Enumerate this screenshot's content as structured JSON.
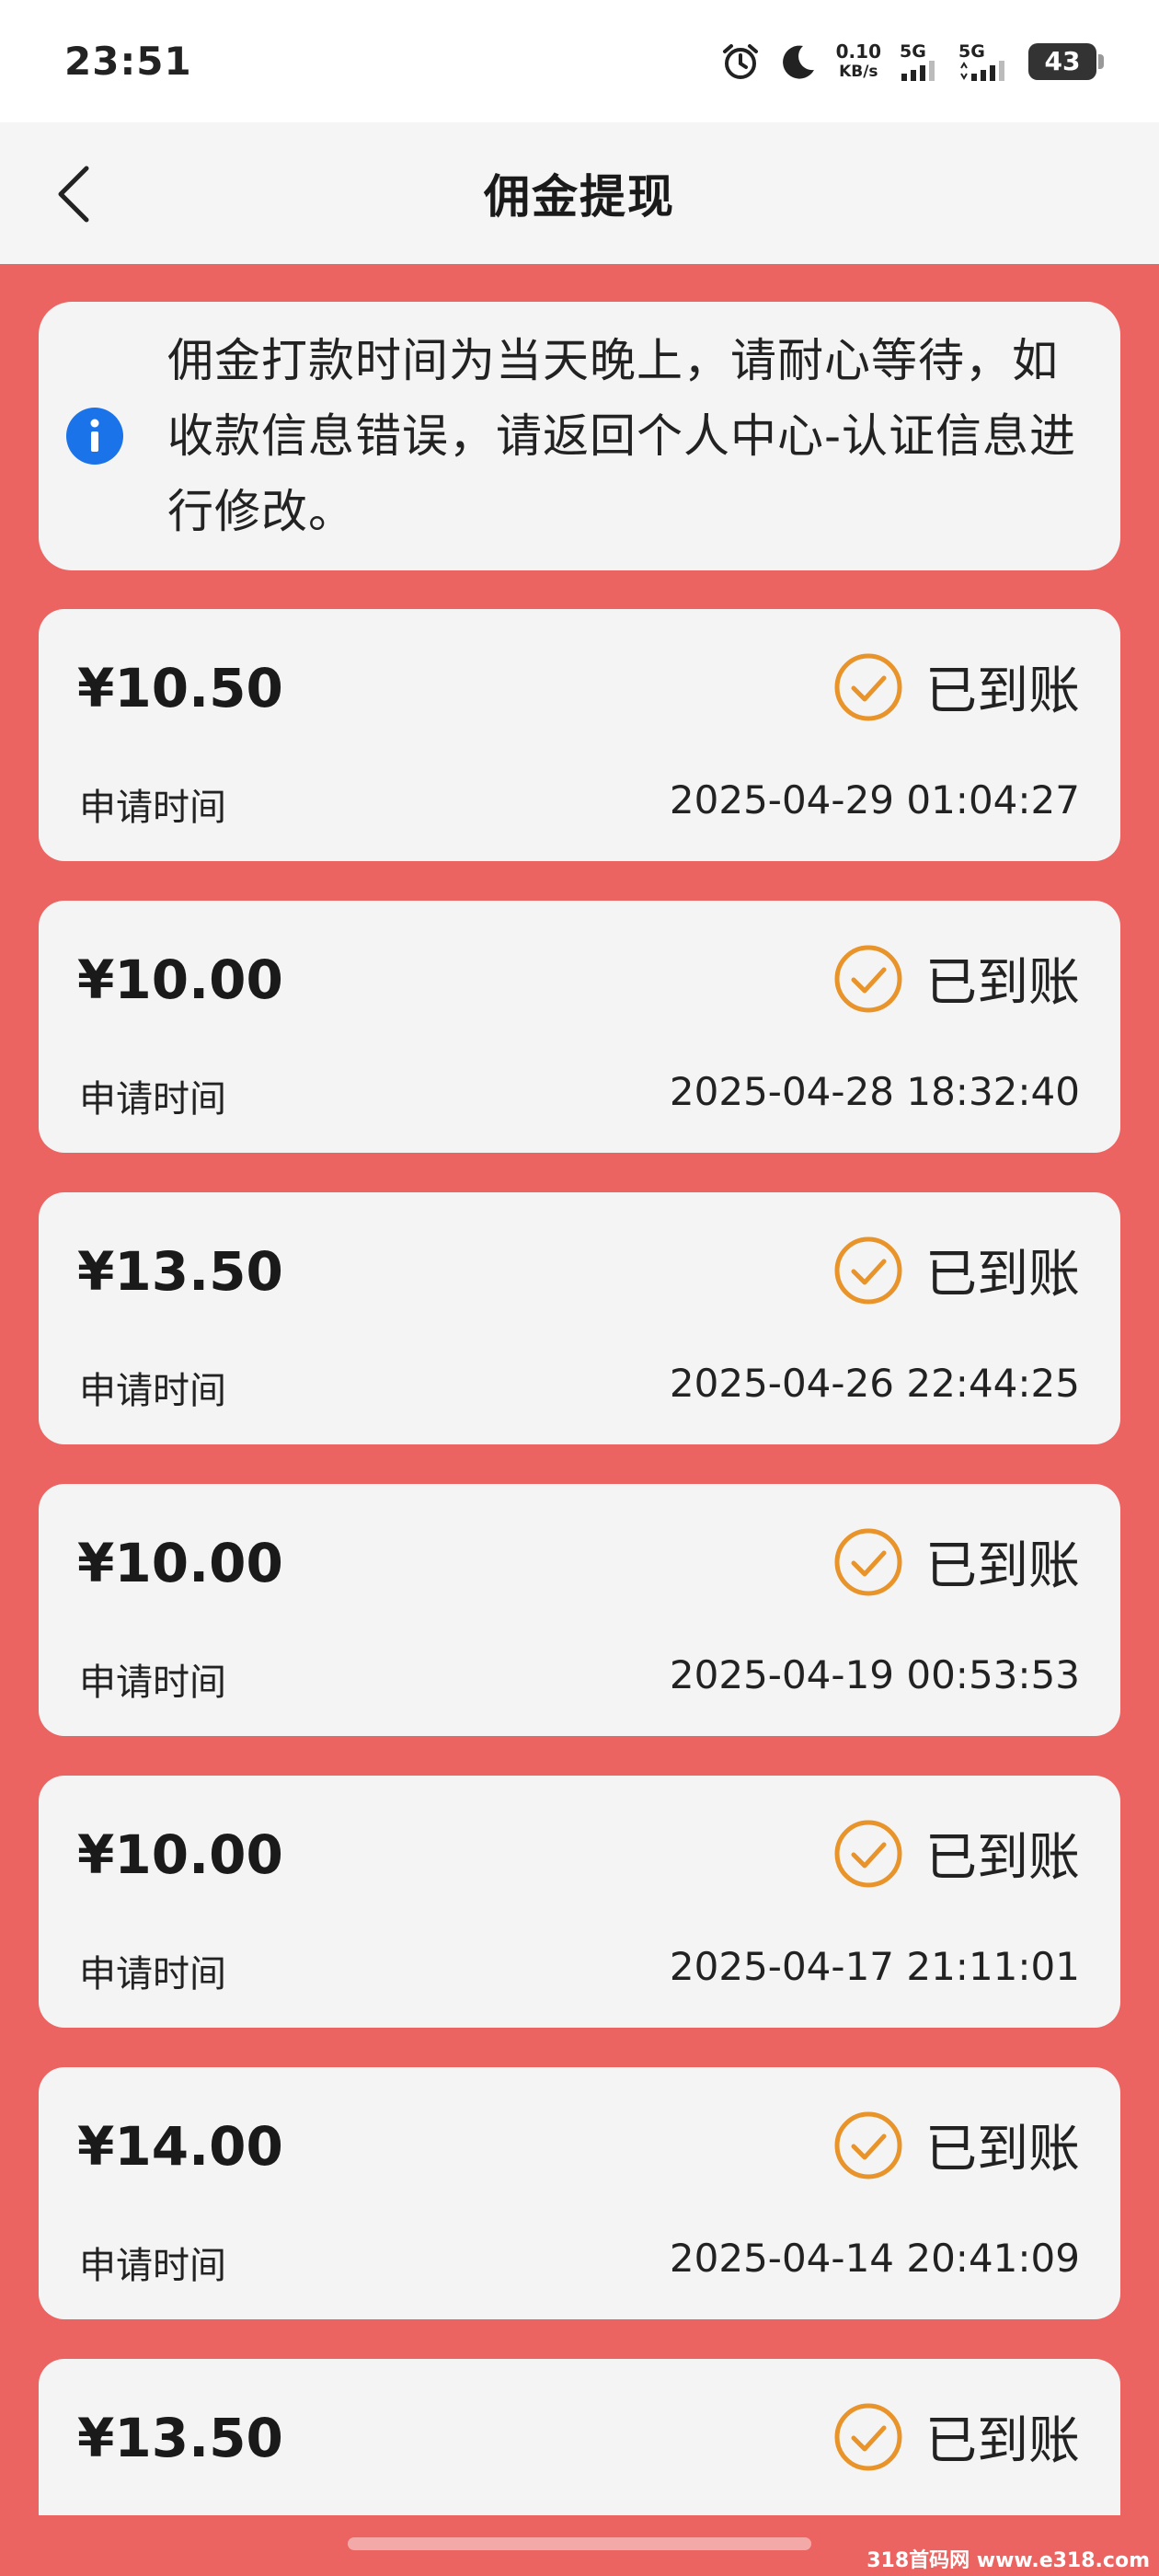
{
  "status_bar": {
    "time": "23:51",
    "net_speed_value": "0.10",
    "net_speed_unit": "KB/s",
    "signal_1_label": "5G",
    "signal_2_label": "5G",
    "battery": "43",
    "icons": [
      "alarm-icon",
      "moon-icon",
      "signal-icon",
      "battery-icon"
    ]
  },
  "nav": {
    "title": "佣金提现",
    "back_icon": "chevron-left-icon"
  },
  "notice": {
    "icon": "info-icon",
    "text": "佣金打款时间为当天晚上，请耐心等待，如收款信息错误，请返回个人中心-认证信息进行修改。"
  },
  "records": [
    {
      "amount": "¥10.50",
      "status": "已到账",
      "label": "申请时间",
      "time": "2025-04-29 01:04:27"
    },
    {
      "amount": "¥10.00",
      "status": "已到账",
      "label": "申请时间",
      "time": "2025-04-28 18:32:40"
    },
    {
      "amount": "¥13.50",
      "status": "已到账",
      "label": "申请时间",
      "time": "2025-04-26 22:44:25"
    },
    {
      "amount": "¥10.00",
      "status": "已到账",
      "label": "申请时间",
      "time": "2025-04-19 00:53:53"
    },
    {
      "amount": "¥10.00",
      "status": "已到账",
      "label": "申请时间",
      "time": "2025-04-17 21:11:01"
    },
    {
      "amount": "¥14.00",
      "status": "已到账",
      "label": "申请时间",
      "time": "2025-04-14 20:41:09"
    },
    {
      "amount": "¥13.50",
      "status": "已到账"
    }
  ],
  "colors": {
    "background": "#ec6461",
    "card": "#f4f4f4",
    "status_check": "#e8942a",
    "info": "#1a73e8"
  },
  "watermark": "318首码网 www.e318.com"
}
